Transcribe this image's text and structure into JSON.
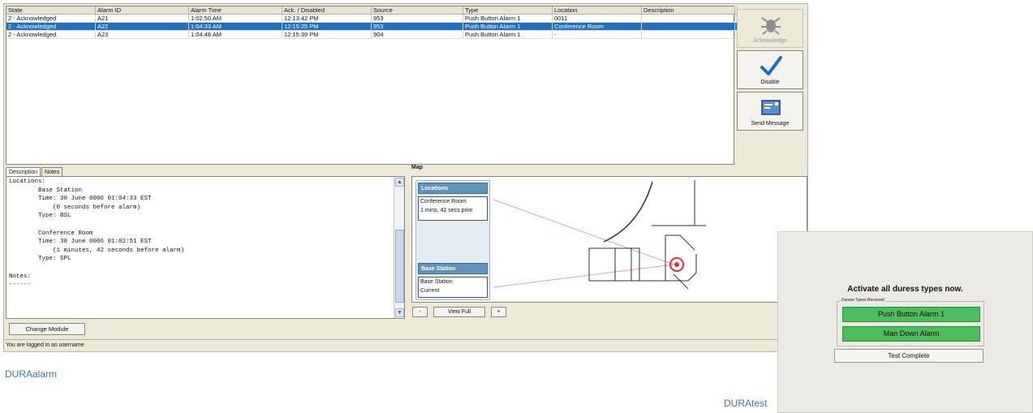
{
  "table": {
    "columns": [
      "State",
      "Alarm ID",
      "Alarm Time",
      "Ack. / Disabled",
      "Source",
      "Type",
      "Location",
      "Description"
    ],
    "rows": [
      {
        "state": "2 - Acknowledged",
        "alarm_id": "A21",
        "alarm_time": "1:02:50 AM",
        "ack": "12:13:42 PM",
        "source": "953",
        "type": "Push Button Alarm 1",
        "location": "0011",
        "description": ""
      },
      {
        "state": "2 - Acknowledged",
        "alarm_id": "A22",
        "alarm_time": "1:04:33 AM",
        "ack": "12:15:25 PM",
        "source": "953",
        "type": "Push Button Alarm 1",
        "location": "Conference Room",
        "description": ""
      },
      {
        "state": "2 - Acknowledged",
        "alarm_id": "A23",
        "alarm_time": "1:04:48 AM",
        "ack": "12:15:39 PM",
        "source": "904",
        "type": "Push Button Alarm 1",
        "location": "-",
        "description": ""
      }
    ]
  },
  "actions": {
    "acknowledge": "Acknowledge",
    "disable": "Disable",
    "send_message": "Send Message"
  },
  "tabs": {
    "description": "Description",
    "notes": "Notes"
  },
  "description_text": "Locations:\n        Base Station\n        Time: 30 June 0006 01:04:33 EST\n            (0 seconds before alarm)\n        Type: BSL\n\n        Conference Room\n        Time: 30 June 0006 01:02:51 EST\n            (1 minutes, 42 seconds before alarm)\n        Type: SPL\n\nNotes:\n------",
  "map": {
    "title": "Map",
    "locations_header": "Locations",
    "location_name": "Conference Room",
    "location_time": "1 mins, 42 secs prior",
    "base_header": "Base Station",
    "base_name": "Base Station",
    "base_time": "Current",
    "zoom_out": "-",
    "view_full": "View Full",
    "zoom_in": "+"
  },
  "change_module": "Change Module",
  "status": "You are logged in as username",
  "captions": {
    "alarm": "DURAalarm",
    "test": "DURAtest"
  },
  "test_panel": {
    "title": "Activate all duress types now.",
    "group_label": "Duress Types Received",
    "items": [
      "Push Button Alarm 1",
      "Man Down Alarm"
    ],
    "button": "Test Complete"
  },
  "colors": {
    "selection": "#1f6fbf",
    "duress_green": "#4cbc5c",
    "caption": "#3e78a6",
    "map_header": "#5f93b8"
  },
  "selected_row": 1
}
